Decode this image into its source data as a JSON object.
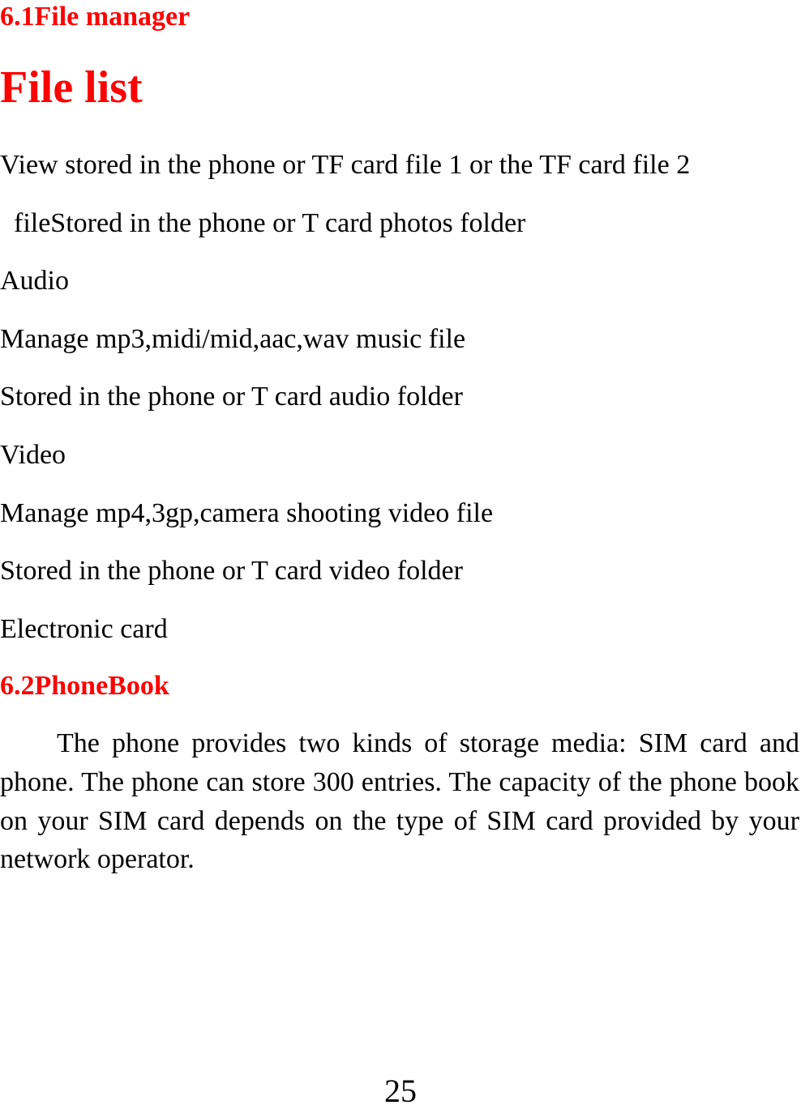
{
  "section1": {
    "header": "6.1File manager",
    "title": "File list",
    "p1": "View stored in the phone or TF card file 1 or the    TF card file 2",
    "p2": "  fileStored in the phone or T card photos folder",
    "p3": "Audio",
    "p4": "Manage mp3,midi/mid,aac,wav music file",
    "p5": "Stored in the phone or T card audio folder",
    "p6": "Video",
    "p7": "Manage mp4,3gp,camera shooting video file",
    "p8": "Stored in the phone or T card video folder",
    "p9": "Electronic card"
  },
  "section2": {
    "header": "6.2PhoneBook",
    "p1": "The phone provides two kinds of storage media: SIM card and phone. The phone can store 300 entries. The capacity of the phone book on your SIM card depends on the type of SIM card provided by your network operator."
  },
  "page_number": "25"
}
